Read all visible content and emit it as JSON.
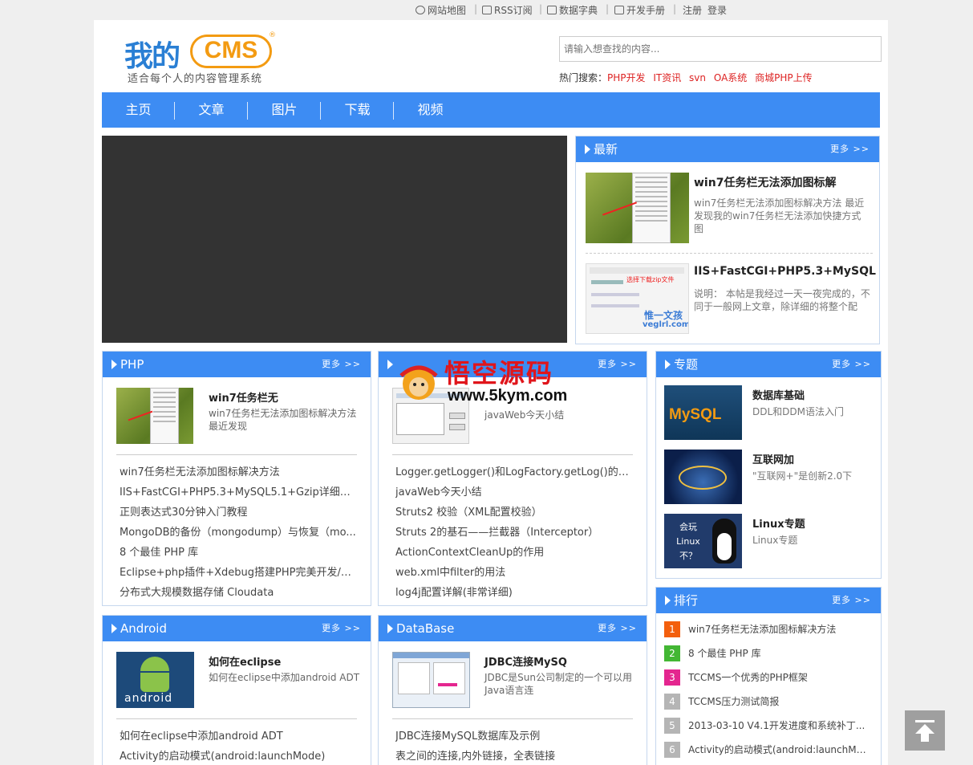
{
  "topbar": {
    "sitemap": "网站地图",
    "rss": "RSS订阅",
    "dict": "数据字典",
    "manual": "开发手册",
    "register": "注册",
    "login": "登录",
    "sep": "|"
  },
  "logo": {
    "main": "我的",
    "cms": "CMS",
    "reg": "®",
    "slogan": "适合每个人的内容管理系统"
  },
  "search": {
    "placeholder": "请输入想查找的内容..."
  },
  "hot": {
    "label": "热门搜索：",
    "keywords": [
      "PHP开发",
      "IT资讯",
      "svn",
      "OA系统",
      "商城PHP上传"
    ]
  },
  "nav": [
    "主页",
    "文章",
    "图片",
    "下载",
    "视频"
  ],
  "more": "更多 >>",
  "latest": {
    "title": "最新",
    "items": [
      {
        "title": "win7任务栏无法添加图标解",
        "desc": "win7任务栏无法添加图标解决方法 最近发现我的win7任务栏无法添加快捷方式图"
      },
      {
        "title": "IIS+FastCGI+PHP5.3+MySQL",
        "desc": "说明： 本帖是我经过一天一夜完成的，不同于一般网上文章，除详细的将整个配",
        "thumb_text": "选择下载zip文件",
        "thumb_brand": "惟一文孩",
        "thumb_url": "veglrl.com"
      }
    ]
  },
  "php": {
    "title": "PHP",
    "feat_title": "win7任务栏无",
    "feat_desc": "win7任务栏无法添加图标解决方法最近发现",
    "list": [
      "win7任务栏无法添加图标解决方法",
      "IIS+FastCGI+PHP5.3+MySQL5.1+Gzip详细教程",
      "正则表达式30分钟入门教程",
      "MongoDB的备份（mongodump）与恢复（mo...",
      "8 个最佳 PHP 库",
      "Eclipse+php插件+Xdebug搭建PHP完美开发/调...",
      "分布式大规模数据存储 Cloudata"
    ]
  },
  "java": {
    "feat_desc": "javaWeb今天小结",
    "list": [
      "Logger.getLogger()和LogFactory.getLog()的区别",
      "javaWeb今天小结",
      "Struts2 校验（XML配置校验）",
      "Struts 2的基石——拦截器（Interceptor）",
      "ActionContextCleanUp的作用",
      "web.xml中filter的用法",
      "log4j配置详解(非常详细)"
    ]
  },
  "topic": {
    "title": "专题",
    "items": [
      {
        "title": "数据库基础",
        "desc": "DDL和DDM语法入门",
        "thumb_text": "MySQL"
      },
      {
        "title": "互联网加",
        "desc": "\"互联网+\"是创新2.0下"
      },
      {
        "title": "Linux专题",
        "desc": "Linux专题",
        "thumb_text": "会玩 Linux 不？"
      }
    ]
  },
  "android": {
    "title": "Android",
    "feat_title": "如何在eclipse",
    "feat_desc": "如何在eclipse中添加android ADT",
    "thumb_text": "android",
    "list": [
      "如何在eclipse中添加android ADT",
      "Activity的启动模式(android:launchMode)"
    ]
  },
  "database": {
    "title": "DataBase",
    "feat_title": "JDBC连接MySQ",
    "feat_desc": "JDBC是Sun公司制定的一个可以用Java语言连",
    "list": [
      "JDBC连接MySQL数据库及示例",
      "表之间的连接,内外链接，全表链接"
    ]
  },
  "rank": {
    "title": "排行",
    "items": [
      {
        "n": "1",
        "text": "win7任务栏无法添加图标解决方法",
        "color": "#f35f0d"
      },
      {
        "n": "2",
        "text": "8 个最佳 PHP 库",
        "color": "#43b734"
      },
      {
        "n": "3",
        "text": "TCCMS一个优秀的PHP框架",
        "color": "#e4268f"
      },
      {
        "n": "4",
        "text": "TCCMS压力测试简报",
        "color": "#b5b5b5"
      },
      {
        "n": "5",
        "text": "2013-03-10 V4.1开发进度和系统补丁...",
        "color": "#b5b5b5"
      },
      {
        "n": "6",
        "text": "Activity的启动模式(android:launchMo...",
        "color": "#b5b5b5"
      }
    ]
  },
  "watermark": {
    "name": "悟空源码",
    "url": "www.5kym.com"
  }
}
